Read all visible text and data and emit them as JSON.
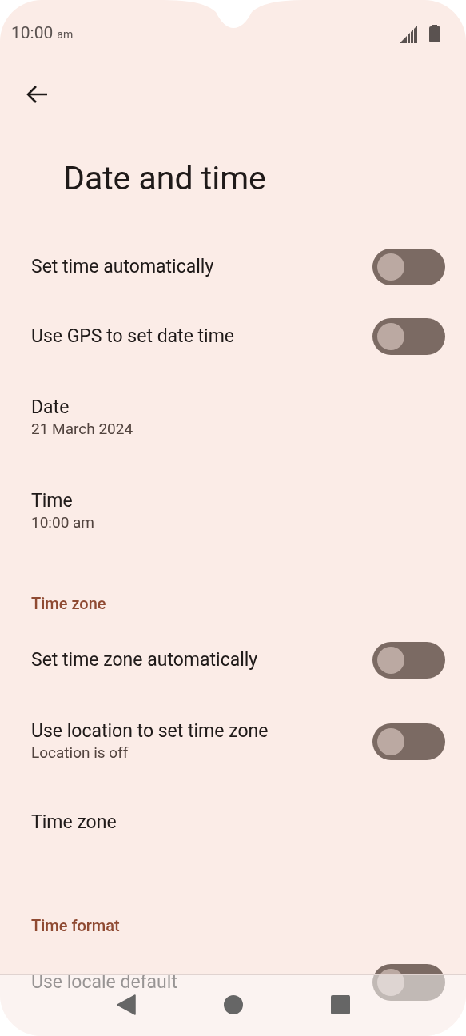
{
  "status_bar": {
    "time": "10:00",
    "ampm": "am"
  },
  "title": "Date and time",
  "items": [
    {
      "kind": "toggle",
      "title": "Set time automatically",
      "on": false
    },
    {
      "kind": "toggle",
      "title": "Use GPS to set date time",
      "on": false
    },
    {
      "kind": "value",
      "title": "Date",
      "summary": "21 March 2024"
    },
    {
      "kind": "value",
      "title": "Time",
      "summary": "10:00 am"
    },
    {
      "kind": "header",
      "title": "Time zone"
    },
    {
      "kind": "toggle",
      "title": "Set time zone automatically",
      "on": false
    },
    {
      "kind": "toggle",
      "title": "Use location to set time zone",
      "summary": "Location is off",
      "on": false
    },
    {
      "kind": "link",
      "title": "Time zone"
    },
    {
      "kind": "header",
      "title": "Time format"
    },
    {
      "kind": "toggle",
      "title": "Use locale default",
      "on": false
    }
  ]
}
